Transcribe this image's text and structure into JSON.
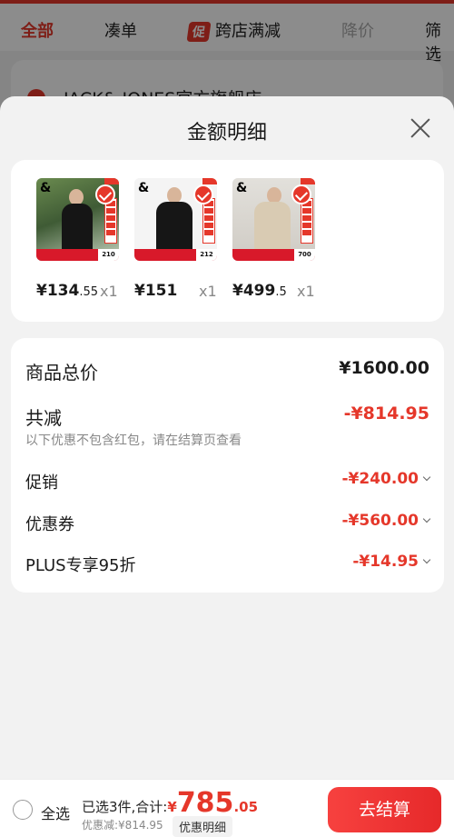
{
  "background": {
    "tabs": [
      "全部",
      "凑单",
      "跨店满减",
      "降价",
      "筛选"
    ],
    "promo_badge": "促",
    "shop_name": "JACK& JONES官方旗舰店"
  },
  "sheet": {
    "title": "金额明细",
    "products": [
      {
        "price_int": "¥134",
        "price_dec": ".55",
        "qty": "x1",
        "tag": "210",
        "promo": "至高立减200减30"
      },
      {
        "price_int": "¥151",
        "price_dec": "",
        "qty": "x1",
        "tag": "212",
        "promo": "至高立减200减30"
      },
      {
        "price_int": "¥499",
        "price_dec": ".5",
        "qty": "x1",
        "tag": "700",
        "promo": "至高立减200减30"
      }
    ],
    "price_rows": {
      "total_label": "商品总价",
      "total_value": "¥1600.00",
      "discount_label": "共减",
      "discount_value": "-¥814.95",
      "discount_note": "以下优惠不包含红包，请在结算页查看",
      "items": [
        {
          "label": "促销",
          "value": "-¥240.00"
        },
        {
          "label": "优惠券",
          "value": "-¥560.00"
        },
        {
          "label": "PLUS专享95折",
          "value": "-¥14.95"
        }
      ]
    }
  },
  "bottom_bar": {
    "select_all": "全选",
    "summary_label": "已选3件,合计:",
    "currency": "¥",
    "total_int": "785",
    "total_dec": ".05",
    "discount_text": "优惠减:¥814.95",
    "detail_button": "优惠明细",
    "checkout_button": "去结算"
  },
  "colors": {
    "accent": "#e5372a",
    "background": "#f2f2f2"
  }
}
